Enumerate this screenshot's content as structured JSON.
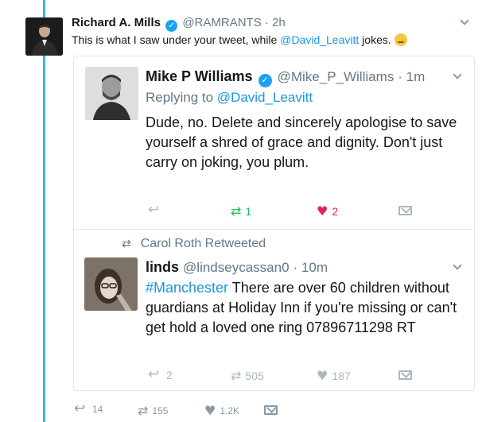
{
  "tweet": {
    "author_name": "Richard A. Mills",
    "author_handle": "@RAMRANTS",
    "time": "· 2h",
    "text_before": "This is what I saw under your tweet, while ",
    "text_mention": "@David_Leavitt",
    "text_after": " jokes.",
    "emoji": "sweat-emoji",
    "stats": {
      "replies": "14",
      "retweets": "155",
      "likes": "1.2K"
    }
  },
  "quoted_reply": {
    "author_name": "Mike P Williams",
    "author_handle": "@Mike_P_Williams",
    "time": "· 1m",
    "replying_label": "Replying to ",
    "replying_to": "@David_Leavitt",
    "text": "Dude, no. Delete and sincerely apologise to save yourself a shred of grace and dignity. Don't just carry on joking, you plum.",
    "stats": {
      "retweets": "1",
      "likes": "2"
    }
  },
  "retweet": {
    "retweeted_by": "Carol Roth Retweeted",
    "author_name": "linds",
    "author_handle": "@lindseycassan0",
    "time": "· 10m",
    "hashtag": "#Manchester",
    "text": " There are over 60 children without guardians at Holiday Inn if you're missing or can't get hold a loved one ring 07896711298 RT",
    "stats": {
      "replies": "2",
      "retweets": "505",
      "likes": "187"
    }
  },
  "colors": {
    "accent": "#1da1f2",
    "retweet_green": "#17bf63",
    "like_red": "#e0245e",
    "muted": "#657786"
  }
}
